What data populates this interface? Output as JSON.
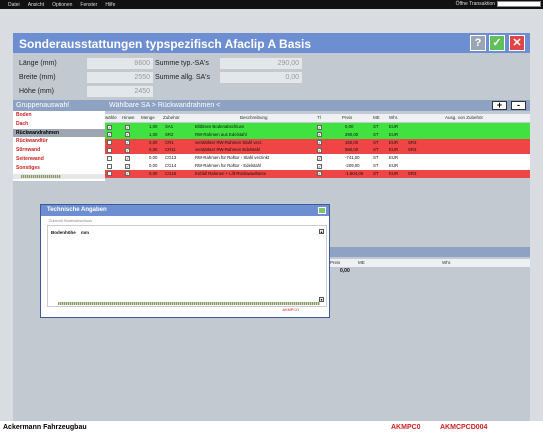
{
  "menubar": {
    "items": [
      "Datei",
      "Ansicht",
      "Optionen",
      "Fenster",
      "Hilfe"
    ],
    "transaction_label": "Öffne Transaktion"
  },
  "header": {
    "title": "Sonderausstattungen typspezifisch  Afaclip A Basis",
    "help_label": "?",
    "ok_label": "✓",
    "close_label": "✕"
  },
  "fields": {
    "laenge_label": "Länge (mm)",
    "laenge_value": "8600",
    "breite_label": "Breite (mm)",
    "breite_value": "2550",
    "hoehe_label": "Höhe (mm)",
    "hoehe_value": "2450",
    "summe_typ_label": "Summe typ.-SA's",
    "summe_typ_value": "290,00",
    "summe_allg_label": "Summe allg. SA's",
    "summe_allg_value": "0,00"
  },
  "groups": {
    "header": "Gruppenauswahl",
    "items": [
      "Boden",
      "Dach",
      "Rückwandrahmen",
      "Rückwandtür",
      "Stirnwand",
      "Seitenwand",
      "Sonstiges"
    ],
    "selected_index": 2
  },
  "sa_panel": {
    "header": "Wählbare SA  > Rückwandrahmen <",
    "add_label": "+",
    "remove_label": "-",
    "columns": [
      "wähle",
      "Hinwe",
      "Menge",
      "Zubehör",
      "Beschreibung",
      "Tl",
      "Preis",
      "ME",
      "Whr.",
      "Ausg. von Zubehör"
    ],
    "rows": [
      {
        "menge": "1,00",
        "zubehoer": "SA1",
        "beschreibung": "Blitlösen Bodenabschluss",
        "preis": "0,00",
        "me": "ST",
        "whr": "EUR",
        "ausg": "",
        "color": "#3fe23f"
      },
      {
        "menge": "1,00",
        "zubehoer": "SR2",
        "beschreibung": "RW-Rahmen aus Edelstahl",
        "preis": "290,00",
        "me": "ST",
        "whr": "EUR",
        "ausg": "",
        "color": "#3fe23f"
      },
      {
        "menge": "0,00",
        "zubehoer": "CR1",
        "beschreibung": "verstärkter RW-Rahmen Stahl verz.",
        "preis": "150,00",
        "me": "ST",
        "whr": "EUR",
        "ausg": "SR3",
        "color": "#f04545"
      },
      {
        "menge": "0,00",
        "zubehoer": "CR11",
        "beschreibung": "verstärkter RW-Rahmen Edelstahl",
        "preis": "590,00",
        "me": "ST",
        "whr": "EUR",
        "ausg": "SR3",
        "color": "#f04545"
      },
      {
        "menge": "0,00",
        "zubehoer": "CG13",
        "beschreibung": "RW-Rahmen für Rolltor - Stahl verzinkt",
        "preis": "-741,00",
        "me": "ST",
        "whr": "EUR",
        "ausg": "",
        "color": "#ffffff"
      },
      {
        "menge": "0,00",
        "zubehoer": "CG14",
        "beschreibung": "RW-Rahmen für Rolltor - Edelstahl",
        "preis": "-209,00",
        "me": "ST",
        "whr": "EUR",
        "ausg": "",
        "color": "#ffffff"
      },
      {
        "menge": "0,00",
        "zubehoer": "CG15",
        "beschreibung": "Entfall Rahmen + Lift-Rückwandtüren",
        "preis": "-1.604,00",
        "me": "ST",
        "whr": "EUR",
        "ausg": "SR3",
        "color": "#f04545"
      }
    ]
  },
  "lower_panel": {
    "columns": [
      "Preis",
      "ME",
      "Whr."
    ],
    "value": "0,00"
  },
  "dialog": {
    "title": "Technische Angaben",
    "subtitle": "Zubehör Bodenabschluss",
    "field_label": "Bodenhöhe",
    "field_unit": "mm",
    "status_text": "AKMPCO"
  },
  "statusbar": {
    "company": "Ackermann Fahrzeugbau",
    "code1": "AKMPC0",
    "code2": "AKMCPCD004"
  }
}
